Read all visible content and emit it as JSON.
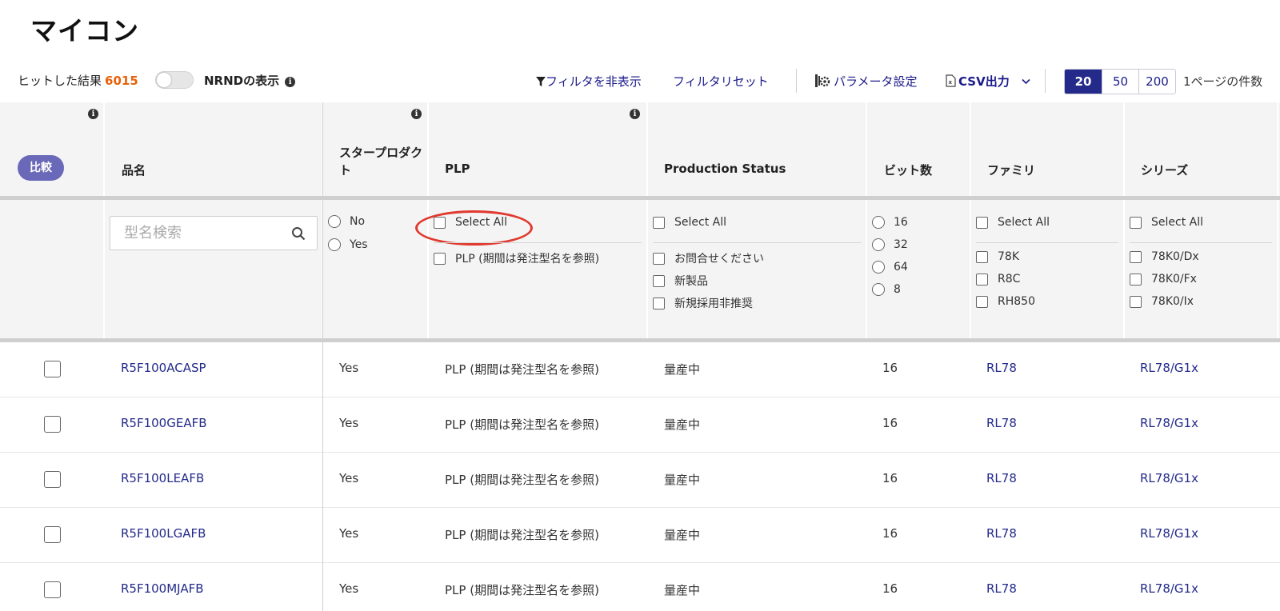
{
  "page_title": "マイコン",
  "toolbar": {
    "hits_label": "ヒットした結果",
    "hits_count": "6015",
    "nrnd_label": "NRNDの表示",
    "hide_filter": "フィルタを非表示",
    "reset_filter": "フィルタリセット",
    "param_settings": "パラメータ設定",
    "csv_output": "CSV出力",
    "page_sizes": [
      "20",
      "50",
      "200"
    ],
    "selected_page_size": "20",
    "per_page_label": "1ページの件数"
  },
  "header": {
    "compare_button": "比較",
    "columns": [
      "品名",
      "スタープロダクト",
      "PLP",
      "Production Status",
      "ビット数",
      "ファミリ",
      "シリーズ"
    ]
  },
  "filters": {
    "search_placeholder": "型名検索",
    "star_product": [
      "No",
      "Yes"
    ],
    "plp": [
      "Select All",
      "PLP (期間は発注型名を参照)"
    ],
    "production_status": [
      "Select All",
      "お問合せください",
      "新製品",
      "新規採用非推奨"
    ],
    "bits": [
      "16",
      "32",
      "64",
      "8"
    ],
    "family": [
      "Select All",
      "78K",
      "R8C",
      "RH850"
    ],
    "series": [
      "Select All",
      "78K0/Dx",
      "78K0/Fx",
      "78K0/Ix"
    ]
  },
  "rows": [
    {
      "name": "R5F100ACASP",
      "star": "Yes",
      "plp": "PLP (期間は発注型名を参照)",
      "status": "量産中",
      "bits": "16",
      "family": "RL78",
      "series": "RL78/G1x"
    },
    {
      "name": "R5F100GEAFB",
      "star": "Yes",
      "plp": "PLP (期間は発注型名を参照)",
      "status": "量産中",
      "bits": "16",
      "family": "RL78",
      "series": "RL78/G1x"
    },
    {
      "name": "R5F100LEAFB",
      "star": "Yes",
      "plp": "PLP (期間は発注型名を参照)",
      "status": "量産中",
      "bits": "16",
      "family": "RL78",
      "series": "RL78/G1x"
    },
    {
      "name": "R5F100LGAFB",
      "star": "Yes",
      "plp": "PLP (期間は発注型名を参照)",
      "status": "量産中",
      "bits": "16",
      "family": "RL78",
      "series": "RL78/G1x"
    },
    {
      "name": "R5F100MJAFB",
      "star": "Yes",
      "plp": "PLP (期間は発注型名を参照)",
      "status": "量産中",
      "bits": "16",
      "family": "RL78",
      "series": "RL78/G1x"
    }
  ]
}
